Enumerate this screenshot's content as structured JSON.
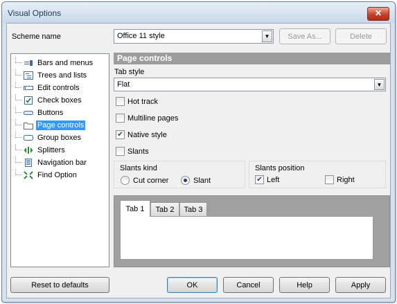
{
  "window": {
    "title": "Visual Options",
    "close_symbol": "✕"
  },
  "scheme": {
    "label": "Scheme name",
    "value": "Office 11 style",
    "save_as_label": "Save As...",
    "delete_label": "Delete"
  },
  "tree": {
    "items": [
      {
        "label": "Bars and menus",
        "icon": "bars-menus-icon"
      },
      {
        "label": "Trees and lists",
        "icon": "tree-list-icon"
      },
      {
        "label": "Edit controls",
        "icon": "edit-control-icon"
      },
      {
        "label": "Check boxes",
        "icon": "checkbox-icon"
      },
      {
        "label": "Buttons",
        "icon": "button-icon"
      },
      {
        "label": "Page controls",
        "icon": "folder-icon",
        "selected": true
      },
      {
        "label": "Group boxes",
        "icon": "group-box-icon"
      },
      {
        "label": "Splitters",
        "icon": "splitter-icon"
      },
      {
        "label": "Navigation bar",
        "icon": "navigation-bar-icon"
      },
      {
        "label": "Find Option",
        "icon": "find-option-icon"
      }
    ]
  },
  "page_controls": {
    "header": "Page controls",
    "tab_style_label": "Tab style",
    "tab_style_value": "Flat",
    "hot_track": {
      "label": "Hot track",
      "checked": false
    },
    "multiline_pages": {
      "label": "Multiline pages",
      "checked": false
    },
    "native_style": {
      "label": "Native style",
      "checked": true
    },
    "slants": {
      "label": "Slants",
      "checked": false
    },
    "slants_kind": {
      "title": "Slants kind",
      "cut_corner": {
        "label": "Cut corner",
        "selected": false
      },
      "slant": {
        "label": "Slant",
        "selected": true
      }
    },
    "slants_position": {
      "title": "Slants position",
      "left": {
        "label": "Left",
        "checked": true
      },
      "right": {
        "label": "Right",
        "checked": false
      }
    },
    "preview_tabs": [
      "Tab 1",
      "Tab 2",
      "Tab 3"
    ]
  },
  "footer": {
    "reset_label": "Reset to defaults",
    "ok_label": "OK",
    "cancel_label": "Cancel",
    "help_label": "Help",
    "apply_label": "Apply"
  },
  "colors": {
    "selection": "#3399ff",
    "header_bar": "#9d9d9d",
    "preview_bg": "#a0a0a0",
    "close_button": "#c6412a"
  }
}
